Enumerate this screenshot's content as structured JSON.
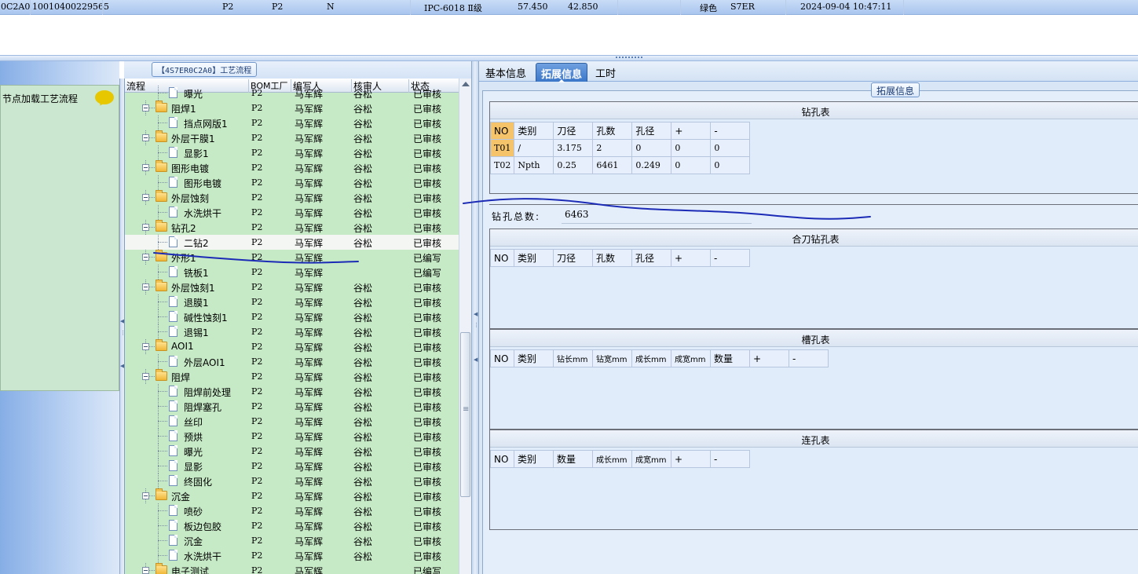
{
  "topbar": {
    "cells": [
      "0C2A0",
      "10010400229565",
      "P2",
      "P2",
      "N",
      "IPC-6018 Ⅱ级",
      "57.450",
      "42.850",
      "绿色",
      "S7ER",
      "2024-09-04 10:47:11"
    ]
  },
  "left_panel": {
    "node_label": "节点加载工艺流程",
    "chat_icon": "speech-bubble-icon"
  },
  "process": {
    "title": "【4S7ER0C2A0】工艺流程",
    "headers": [
      "流程",
      "BOM工厂",
      "编写人",
      "核审人",
      "状态"
    ],
    "rows": [
      {
        "level": 1,
        "type": "doc",
        "name": "曝光",
        "bom": "P2",
        "writer": "马军辉",
        "reviewer": "谷松",
        "status": "已审核"
      },
      {
        "level": 0,
        "type": "folder",
        "name": "阻焊1",
        "bom": "P2",
        "writer": "马军辉",
        "reviewer": "谷松",
        "status": "已审核"
      },
      {
        "level": 1,
        "type": "doc",
        "name": "挡点网版1",
        "bom": "P2",
        "writer": "马军辉",
        "reviewer": "谷松",
        "status": "已审核"
      },
      {
        "level": 0,
        "type": "folder",
        "name": "外层干膜1",
        "bom": "P2",
        "writer": "马军辉",
        "reviewer": "谷松",
        "status": "已审核"
      },
      {
        "level": 1,
        "type": "doc",
        "name": "显影1",
        "bom": "P2",
        "writer": "马军辉",
        "reviewer": "谷松",
        "status": "已审核"
      },
      {
        "level": 0,
        "type": "folder",
        "name": "图形电镀",
        "bom": "P2",
        "writer": "马军辉",
        "reviewer": "谷松",
        "status": "已审核"
      },
      {
        "level": 1,
        "type": "doc",
        "name": "图形电镀",
        "bom": "P2",
        "writer": "马军辉",
        "reviewer": "谷松",
        "status": "已审核"
      },
      {
        "level": 0,
        "type": "folder",
        "name": "外层蚀刻",
        "bom": "P2",
        "writer": "马军辉",
        "reviewer": "谷松",
        "status": "已审核"
      },
      {
        "level": 1,
        "type": "doc",
        "name": "水洗烘干",
        "bom": "P2",
        "writer": "马军辉",
        "reviewer": "谷松",
        "status": "已审核"
      },
      {
        "level": 0,
        "type": "folder",
        "name": "钻孔2",
        "bom": "P2",
        "writer": "马军辉",
        "reviewer": "谷松",
        "status": "已审核"
      },
      {
        "level": 1,
        "type": "doc",
        "name": "二钻2",
        "bom": "P2",
        "writer": "马军辉",
        "reviewer": "谷松",
        "status": "已审核",
        "selected": true
      },
      {
        "level": 0,
        "type": "folder",
        "name": "外形1",
        "bom": "P2",
        "writer": "马军辉",
        "reviewer": "",
        "status": "已编写"
      },
      {
        "level": 1,
        "type": "doc",
        "name": "铣板1",
        "bom": "P2",
        "writer": "马军辉",
        "reviewer": "",
        "status": "已编写"
      },
      {
        "level": 0,
        "type": "folder",
        "name": "外层蚀刻1",
        "bom": "P2",
        "writer": "马军辉",
        "reviewer": "谷松",
        "status": "已审核"
      },
      {
        "level": 1,
        "type": "doc",
        "name": "退膜1",
        "bom": "P2",
        "writer": "马军辉",
        "reviewer": "谷松",
        "status": "已审核"
      },
      {
        "level": 1,
        "type": "doc",
        "name": "碱性蚀刻1",
        "bom": "P2",
        "writer": "马军辉",
        "reviewer": "谷松",
        "status": "已审核"
      },
      {
        "level": 1,
        "type": "doc",
        "name": "退锡1",
        "bom": "P2",
        "writer": "马军辉",
        "reviewer": "谷松",
        "status": "已审核"
      },
      {
        "level": 0,
        "type": "folder",
        "name": "AOI1",
        "bom": "P2",
        "writer": "马军辉",
        "reviewer": "谷松",
        "status": "已审核"
      },
      {
        "level": 1,
        "type": "doc",
        "name": "外层AOI1",
        "bom": "P2",
        "writer": "马军辉",
        "reviewer": "谷松",
        "status": "已审核"
      },
      {
        "level": 0,
        "type": "folder",
        "name": "阻焊",
        "bom": "P2",
        "writer": "马军辉",
        "reviewer": "谷松",
        "status": "已审核"
      },
      {
        "level": 1,
        "type": "doc",
        "name": "阻焊前处理",
        "bom": "P2",
        "writer": "马军辉",
        "reviewer": "谷松",
        "status": "已审核"
      },
      {
        "level": 1,
        "type": "doc",
        "name": "阻焊塞孔",
        "bom": "P2",
        "writer": "马军辉",
        "reviewer": "谷松",
        "status": "已审核"
      },
      {
        "level": 1,
        "type": "doc",
        "name": "丝印",
        "bom": "P2",
        "writer": "马军辉",
        "reviewer": "谷松",
        "status": "已审核"
      },
      {
        "level": 1,
        "type": "doc",
        "name": "预烘",
        "bom": "P2",
        "writer": "马军辉",
        "reviewer": "谷松",
        "status": "已审核"
      },
      {
        "level": 1,
        "type": "doc",
        "name": "曝光",
        "bom": "P2",
        "writer": "马军辉",
        "reviewer": "谷松",
        "status": "已审核"
      },
      {
        "level": 1,
        "type": "doc",
        "name": "显影",
        "bom": "P2",
        "writer": "马军辉",
        "reviewer": "谷松",
        "status": "已审核"
      },
      {
        "level": 1,
        "type": "doc",
        "name": "终固化",
        "bom": "P2",
        "writer": "马军辉",
        "reviewer": "谷松",
        "status": "已审核"
      },
      {
        "level": 0,
        "type": "folder",
        "name": "沉金",
        "bom": "P2",
        "writer": "马军辉",
        "reviewer": "谷松",
        "status": "已审核"
      },
      {
        "level": 1,
        "type": "doc",
        "name": "喷砂",
        "bom": "P2",
        "writer": "马军辉",
        "reviewer": "谷松",
        "status": "已审核"
      },
      {
        "level": 1,
        "type": "doc",
        "name": "板边包胶",
        "bom": "P2",
        "writer": "马军辉",
        "reviewer": "谷松",
        "status": "已审核"
      },
      {
        "level": 1,
        "type": "doc",
        "name": "沉金",
        "bom": "P2",
        "writer": "马军辉",
        "reviewer": "谷松",
        "status": "已审核"
      },
      {
        "level": 1,
        "type": "doc",
        "name": "水洗烘干",
        "bom": "P2",
        "writer": "马军辉",
        "reviewer": "谷松",
        "status": "已审核"
      },
      {
        "level": 0,
        "type": "folder",
        "name": "电子测试",
        "bom": "P2",
        "writer": "马军辉",
        "reviewer": "",
        "status": "已编写"
      }
    ]
  },
  "tabs": [
    {
      "label": "基本信息",
      "active": false
    },
    {
      "label": "拓展信息",
      "active": true
    },
    {
      "label": "工时",
      "active": false
    }
  ],
  "ext": {
    "legend": "拓展信息",
    "drill_table": {
      "title": "钻孔表",
      "headers": [
        "NO",
        "类别",
        "刀径",
        "孔数",
        "孔径",
        "+",
        "-"
      ],
      "rows": [
        [
          "T01",
          "/",
          "3.175",
          "2",
          "0",
          "0",
          "0"
        ],
        [
          "T02",
          "Npth",
          "0.25",
          "6461",
          "0.249",
          "0",
          "0"
        ]
      ]
    },
    "drill_total": {
      "label": "钻孔总数:",
      "value": "6463"
    },
    "combined_table": {
      "title": "合刀钻孔表",
      "headers": [
        "NO",
        "类别",
        "刀径",
        "孔数",
        "孔径",
        "+",
        "-"
      ]
    },
    "slot_table": {
      "title": "槽孔表",
      "headers": [
        "NO",
        "类别",
        "钻长mm",
        "钻宽mm",
        "成长mm",
        "成宽mm",
        "数量",
        "+",
        "-"
      ]
    },
    "chain_table": {
      "title": "连孔表",
      "headers": [
        "NO",
        "类别",
        "数量",
        "成长mm",
        "成宽mm",
        "+",
        "-"
      ]
    }
  },
  "colors": {
    "tree_bg": "#c6e9c6",
    "accent_tab": "#3a76c9",
    "annotation_ink": "#1c2bb5",
    "no_header": "#f4c36a"
  }
}
